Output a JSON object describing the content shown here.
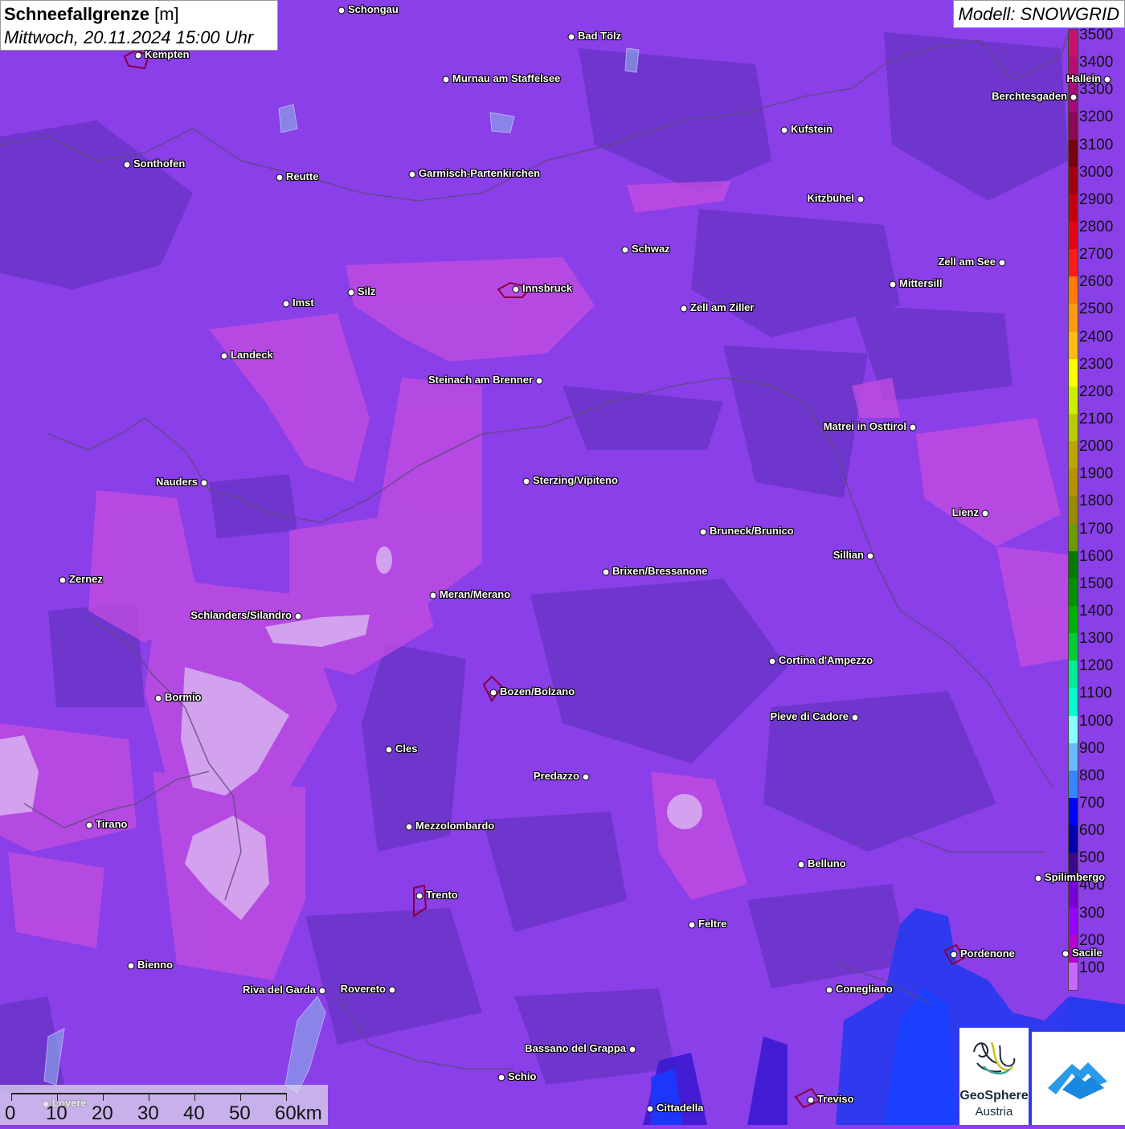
{
  "title": {
    "parameter": "Schneefallgrenze",
    "unit": "[m]",
    "datetime": "Mittwoch, 20.11.2024 15:00 Uhr"
  },
  "model": "Modell: SNOWGRID",
  "legend": {
    "labels": [
      "3500",
      "3400",
      "3300",
      "3200",
      "3100",
      "3000",
      "2900",
      "2800",
      "2700",
      "2600",
      "2500",
      "2400",
      "2300",
      "2200",
      "2100",
      "2000",
      "1900",
      "1800",
      "1700",
      "1600",
      "1500",
      "1400",
      "1300",
      "1200",
      "1100",
      "1000",
      "900",
      "800",
      "700",
      "600",
      "500",
      "400",
      "300",
      "200",
      "100"
    ],
    "colors": [
      "#c8126e",
      "#b80c75",
      "#a7097a",
      "#8e0655",
      "#7a0010",
      "#a00010",
      "#c40010",
      "#e40018",
      "#ff1a1a",
      "#ff7a00",
      "#ff9a10",
      "#ffbb10",
      "#ffff00",
      "#ccee00",
      "#b8cc00",
      "#bba700",
      "#b89000",
      "#9a8a00",
      "#6e9a00",
      "#007a00",
      "#009000",
      "#00b000",
      "#00cc33",
      "#00ee99",
      "#00ffcc",
      "#88ffff",
      "#66bbff",
      "#3388ff",
      "#0000ff",
      "#0000b0",
      "#3a0a8a",
      "#7a00d8",
      "#9900ff",
      "#b600cc",
      "#cc66ff"
    ]
  },
  "cities": [
    {
      "name": "Schongau"
    },
    {
      "name": "Bad Tölz"
    },
    {
      "name": "Kempten"
    },
    {
      "name": "Murnau am Staffelsee"
    },
    {
      "name": "Hallein"
    },
    {
      "name": "Berchtesgaden"
    },
    {
      "name": "Kufstein"
    },
    {
      "name": "Sonthofen"
    },
    {
      "name": "Reutte"
    },
    {
      "name": "Garmisch-Partenkirchen"
    },
    {
      "name": "Kitzbühel"
    },
    {
      "name": "Schwaz"
    },
    {
      "name": "Zell am See"
    },
    {
      "name": "Innsbruck"
    },
    {
      "name": "Mittersill"
    },
    {
      "name": "Imst"
    },
    {
      "name": "Silz"
    },
    {
      "name": "Zell am Ziller"
    },
    {
      "name": "Landeck"
    },
    {
      "name": "Steinach am Brenner"
    },
    {
      "name": "Matrei in Osttirol"
    },
    {
      "name": "Nauders"
    },
    {
      "name": "Sterzing/Vipiteno"
    },
    {
      "name": "Lienz"
    },
    {
      "name": "Bruneck/Brunico"
    },
    {
      "name": "Sillian"
    },
    {
      "name": "Zernez"
    },
    {
      "name": "Brixen/Bressanone"
    },
    {
      "name": "Meran/Merano"
    },
    {
      "name": "Schlanders/Silandro"
    },
    {
      "name": "Cortina d'Ampezzo"
    },
    {
      "name": "Bozen/Bolzano"
    },
    {
      "name": "Bormio"
    },
    {
      "name": "Pieve di Cadore"
    },
    {
      "name": "Cles"
    },
    {
      "name": "Predazzo"
    },
    {
      "name": "Tirano"
    },
    {
      "name": "Mezzolombardo"
    },
    {
      "name": "Belluno"
    },
    {
      "name": "Spilimbergo"
    },
    {
      "name": "Trento"
    },
    {
      "name": "Feltre"
    },
    {
      "name": "Pordenone"
    },
    {
      "name": "Bienno"
    },
    {
      "name": "Riva del Garda"
    },
    {
      "name": "Rovereto"
    },
    {
      "name": "Conegliano"
    },
    {
      "name": "Bassano del Grappa"
    },
    {
      "name": "Schio"
    },
    {
      "name": "Treviso"
    },
    {
      "name": "Cittadella"
    },
    {
      "name": "Lovere"
    },
    {
      "name": "Sacile"
    }
  ],
  "scale": {
    "labels": [
      "0",
      "10",
      "20",
      "30",
      "40",
      "50",
      "60km"
    ]
  },
  "logos": {
    "geosphere_line1": "GeoSphere",
    "geosphere_line2": "Austria"
  }
}
